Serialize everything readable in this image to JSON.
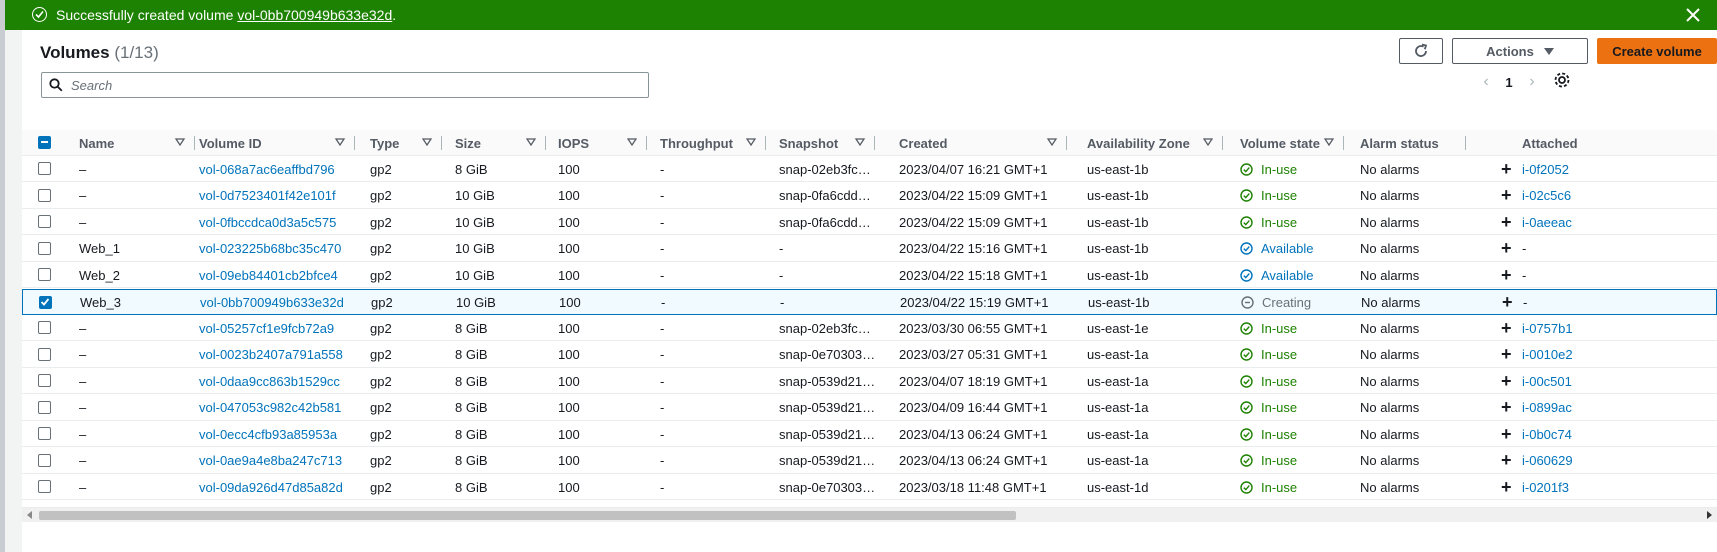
{
  "flash": {
    "message_prefix": "Successfully created volume ",
    "volume_link": "vol-0bb700949b633e32d",
    "message_suffix": "."
  },
  "header": {
    "title": "Volumes",
    "count": "(1/13)",
    "actions_label": "Actions",
    "create_label": "Create volume"
  },
  "search": {
    "placeholder": "Search",
    "value": ""
  },
  "pagination": {
    "page": "1"
  },
  "columns": [
    "Name",
    "Volume ID",
    "Type",
    "Size",
    "IOPS",
    "Throughput",
    "Snapshot",
    "Created",
    "Availability Zone",
    "Volume state",
    "Alarm status",
    "Attached"
  ],
  "rows": [
    {
      "name": "–",
      "id": "vol-068a7ac6eaffbd796",
      "type": "gp2",
      "size": "8 GiB",
      "iops": "100",
      "throughput": "-",
      "snapshot": "snap-02eb3fc…",
      "created": "2023/04/07 16:21 GMT+1",
      "az": "us-east-1b",
      "state": "In-use",
      "alarm": "No alarms",
      "attached": "i-0f2052",
      "checked": false
    },
    {
      "name": "–",
      "id": "vol-0d7523401f42e101f",
      "type": "gp2",
      "size": "10 GiB",
      "iops": "100",
      "throughput": "-",
      "snapshot": "snap-0fa6cdd…",
      "created": "2023/04/22 15:09 GMT+1",
      "az": "us-east-1b",
      "state": "In-use",
      "alarm": "No alarms",
      "attached": "i-02c5c6",
      "checked": false
    },
    {
      "name": "–",
      "id": "vol-0fbccdca0d3a5c575",
      "type": "gp2",
      "size": "10 GiB",
      "iops": "100",
      "throughput": "-",
      "snapshot": "snap-0fa6cdd…",
      "created": "2023/04/22 15:09 GMT+1",
      "az": "us-east-1b",
      "state": "In-use",
      "alarm": "No alarms",
      "attached": "i-0aeeac",
      "checked": false
    },
    {
      "name": "Web_1",
      "id": "vol-023225b68bc35c470",
      "type": "gp2",
      "size": "10 GiB",
      "iops": "100",
      "throughput": "-",
      "snapshot": "-",
      "created": "2023/04/22 15:16 GMT+1",
      "az": "us-east-1b",
      "state": "Available",
      "alarm": "No alarms",
      "attached": "-",
      "checked": false
    },
    {
      "name": "Web_2",
      "id": "vol-09eb84401cb2bfce4",
      "type": "gp2",
      "size": "10 GiB",
      "iops": "100",
      "throughput": "-",
      "snapshot": "-",
      "created": "2023/04/22 15:18 GMT+1",
      "az": "us-east-1b",
      "state": "Available",
      "alarm": "No alarms",
      "attached": "-",
      "checked": false
    },
    {
      "name": "Web_3",
      "id": "vol-0bb700949b633e32d",
      "type": "gp2",
      "size": "10 GiB",
      "iops": "100",
      "throughput": "-",
      "snapshot": "-",
      "created": "2023/04/22 15:19 GMT+1",
      "az": "us-east-1b",
      "state": "Creating",
      "alarm": "No alarms",
      "attached": "-",
      "checked": true
    },
    {
      "name": "–",
      "id": "vol-05257cf1e9fcb72a9",
      "type": "gp2",
      "size": "8 GiB",
      "iops": "100",
      "throughput": "-",
      "snapshot": "snap-02eb3fc…",
      "created": "2023/03/30 06:55 GMT+1",
      "az": "us-east-1e",
      "state": "In-use",
      "alarm": "No alarms",
      "attached": "i-0757b1",
      "checked": false
    },
    {
      "name": "–",
      "id": "vol-0023b2407a791a558",
      "type": "gp2",
      "size": "8 GiB",
      "iops": "100",
      "throughput": "-",
      "snapshot": "snap-0e70303…",
      "created": "2023/03/27 05:31 GMT+1",
      "az": "us-east-1a",
      "state": "In-use",
      "alarm": "No alarms",
      "attached": "i-0010e2",
      "checked": false
    },
    {
      "name": "–",
      "id": "vol-0daa9cc863b1529cc",
      "type": "gp2",
      "size": "8 GiB",
      "iops": "100",
      "throughput": "-",
      "snapshot": "snap-0539d21…",
      "created": "2023/04/07 18:19 GMT+1",
      "az": "us-east-1a",
      "state": "In-use",
      "alarm": "No alarms",
      "attached": "i-00c501",
      "checked": false
    },
    {
      "name": "–",
      "id": "vol-047053c982c42b581",
      "type": "gp2",
      "size": "8 GiB",
      "iops": "100",
      "throughput": "-",
      "snapshot": "snap-0539d21…",
      "created": "2023/04/09 16:44 GMT+1",
      "az": "us-east-1a",
      "state": "In-use",
      "alarm": "No alarms",
      "attached": "i-0899ac",
      "checked": false
    },
    {
      "name": "–",
      "id": "vol-0ecc4cfb93a85953a",
      "type": "gp2",
      "size": "8 GiB",
      "iops": "100",
      "throughput": "-",
      "snapshot": "snap-0539d21…",
      "created": "2023/04/13 06:24 GMT+1",
      "az": "us-east-1a",
      "state": "In-use",
      "alarm": "No alarms",
      "attached": "i-0b0c74",
      "checked": false
    },
    {
      "name": "–",
      "id": "vol-0ae9a4e8ba247c713",
      "type": "gp2",
      "size": "8 GiB",
      "iops": "100",
      "throughput": "-",
      "snapshot": "snap-0539d21…",
      "created": "2023/04/13 06:24 GMT+1",
      "az": "us-east-1a",
      "state": "In-use",
      "alarm": "No alarms",
      "attached": "i-060629",
      "checked": false
    },
    {
      "name": "–",
      "id": "vol-09da926d47d85a82d",
      "type": "gp2",
      "size": "8 GiB",
      "iops": "100",
      "throughput": "-",
      "snapshot": "snap-0e70303…",
      "created": "2023/03/18 11:48 GMT+1",
      "az": "us-east-1d",
      "state": "In-use",
      "alarm": "No alarms",
      "attached": "i-0201f3",
      "checked": false
    }
  ],
  "colors": {
    "flash_success": "#1d8102",
    "primary_button": "#ec7211",
    "link": "#0073bb",
    "state_in_use": "#1d8102",
    "state_available": "#0073bb",
    "state_creating": "#687078"
  }
}
